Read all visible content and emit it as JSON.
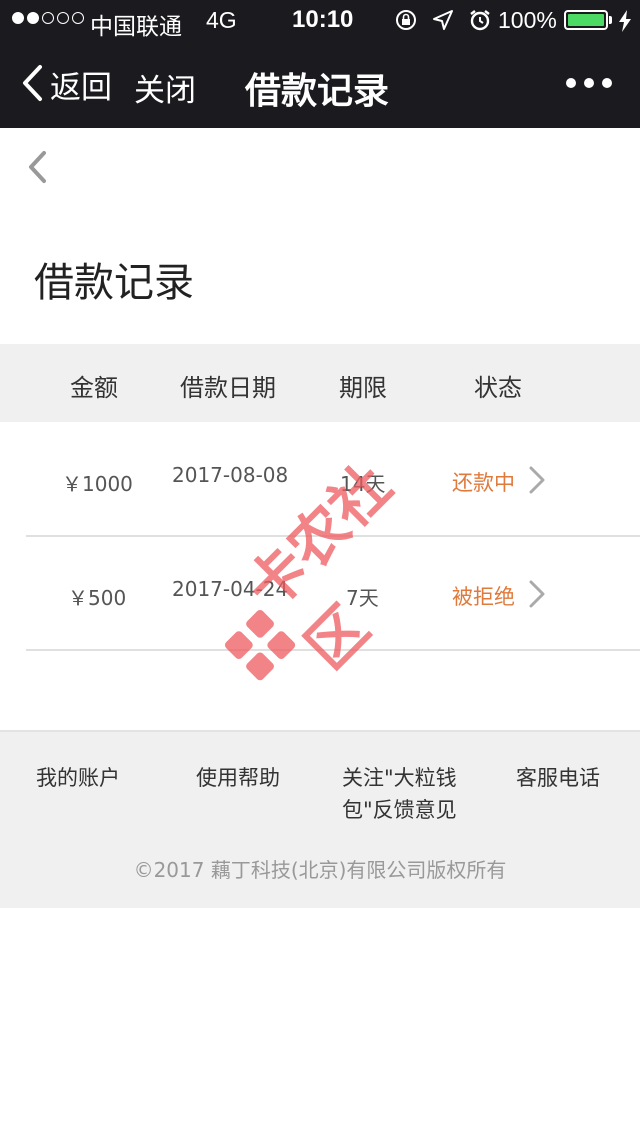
{
  "status_bar": {
    "carrier": "中国联通",
    "network": "4G",
    "time": "10:10",
    "battery": "100%",
    "icons": [
      "orientation-lock-icon",
      "location-icon",
      "alarm-icon",
      "battery-icon",
      "charging-icon"
    ],
    "signal_strength": 2,
    "signal_max": 5
  },
  "nav": {
    "back_label": "返回",
    "close_label": "关闭",
    "title": "借款记录"
  },
  "page": {
    "title": "借款记录"
  },
  "table": {
    "headers": [
      "金额",
      "借款日期",
      "期限",
      "状态"
    ],
    "rows": [
      {
        "amount": "￥1000",
        "date": "2017-08-08",
        "term": "14天",
        "status": "还款中"
      },
      {
        "amount": "￥500",
        "date": "2017-04-24",
        "term": "7天",
        "status": "被拒绝"
      }
    ]
  },
  "footer": {
    "links": [
      "我的账户",
      "使用帮助",
      "关注\"大粒钱包\"反馈意见",
      "客服电话"
    ],
    "link_lines": [
      [
        "我的账户"
      ],
      [
        "使用帮助"
      ],
      [
        "关注\"大粒钱",
        "包\"反馈意见"
      ],
      [
        "客服电话"
      ]
    ],
    "copyright": "©2017 藕丁科技(北京)有限公司版权所有"
  },
  "watermark": {
    "text": "卡农社区"
  },
  "colors": {
    "navbar_bg": "#1b1b1f",
    "status_accent": "#e07a3c",
    "header_bg": "#f0f0f0",
    "battery_green": "#4cd964",
    "watermark": "#ee5a5f"
  }
}
